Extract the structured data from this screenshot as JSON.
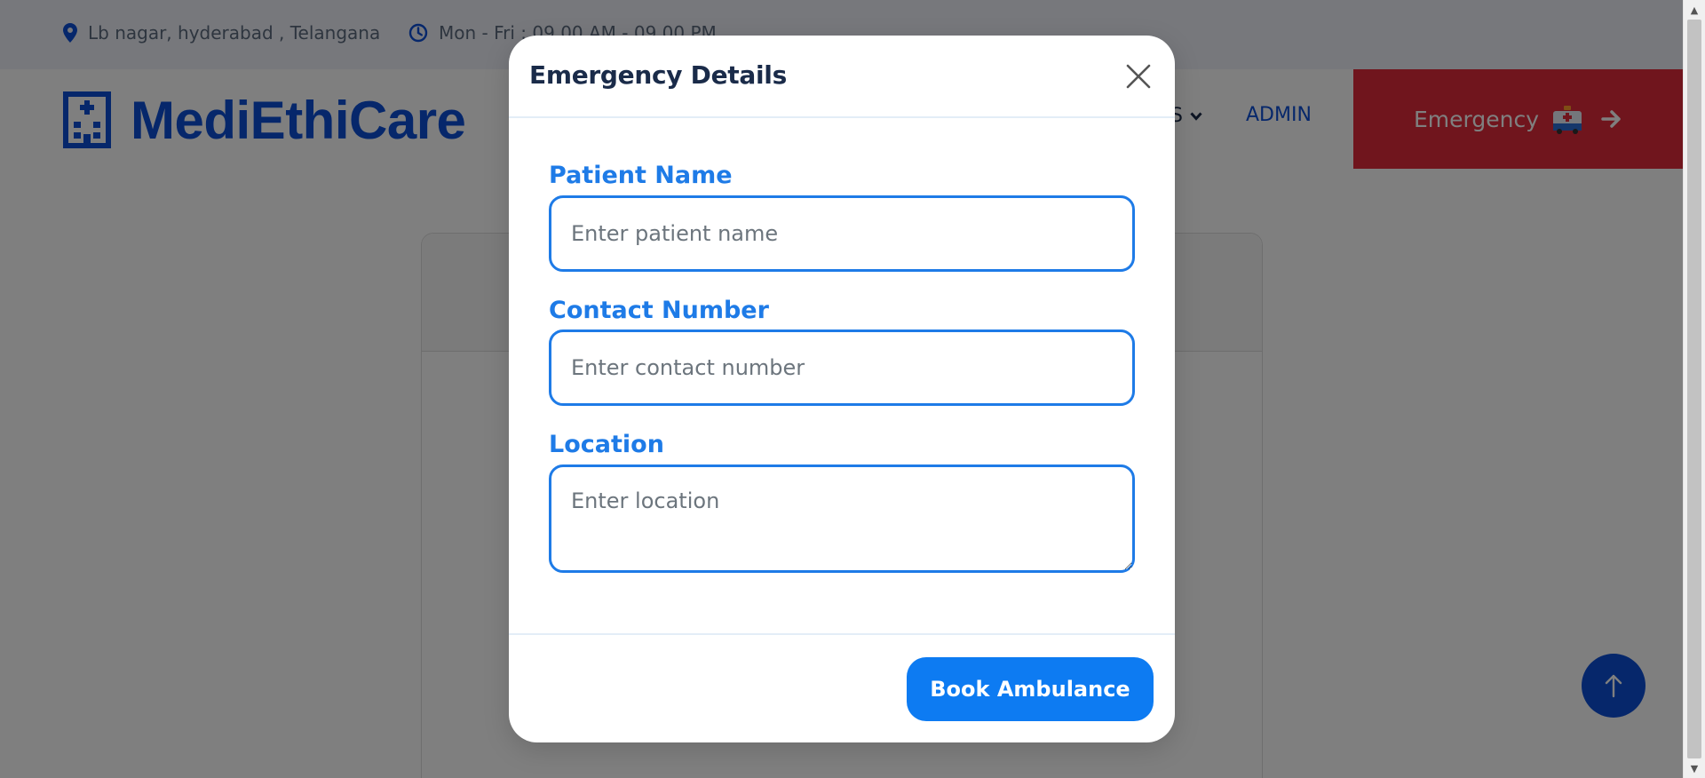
{
  "topbar": {
    "address": "Lb nagar, hyderabad , Telangana",
    "address_icon": "map-pin-icon",
    "hours": "Mon - Fri : 09.00 AM - 09.00 PM",
    "hours_icon": "clock-icon"
  },
  "header": {
    "logo_text": "MediEthiCare",
    "logo_icon": "hospital-building-icon",
    "nav_partial_label": "S",
    "nav_admin_label": "ADMIN",
    "emergency_label": "Emergency",
    "emergency_icon": "ambulance-emoji-icon",
    "emergency_arrow_icon": "arrow-right-icon"
  },
  "modal": {
    "title": "Emergency Details",
    "close_icon": "close-icon",
    "fields": {
      "patient_name": {
        "label": "Patient Name",
        "placeholder": "Enter patient name",
        "value": ""
      },
      "contact_number": {
        "label": "Contact Number",
        "placeholder": "Enter contact number",
        "value": ""
      },
      "location": {
        "label": "Location",
        "placeholder": "Enter location",
        "value": ""
      }
    },
    "submit_label": "Book Ambulance"
  },
  "scroll_top_icon": "arrow-up-icon",
  "colors": {
    "brand_blue": "#0d4fd6",
    "field_accent": "#1e7be7",
    "button_blue": "#0d7bf2",
    "emergency_red": "#e02b3a",
    "overlay": "rgba(0,0,0,0.5)"
  }
}
